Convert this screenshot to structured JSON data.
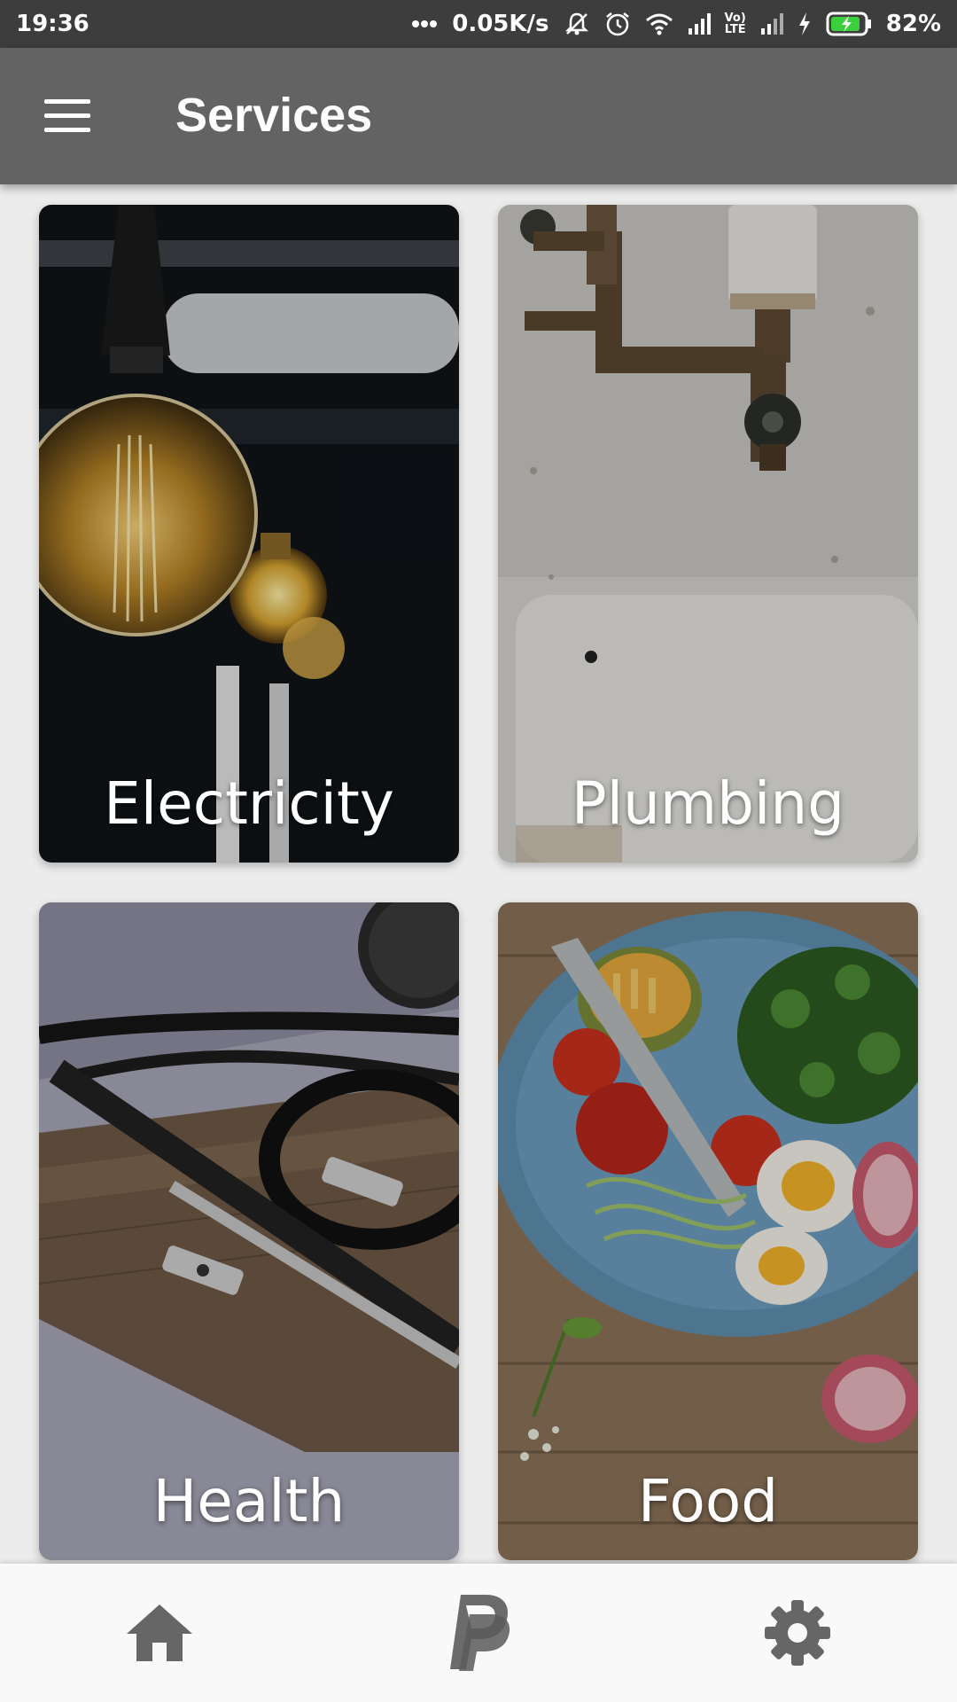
{
  "status_bar": {
    "time": "19:36",
    "network_speed": "0.05K/s",
    "volte_top": "Vo)",
    "volte_bottom": "LTE",
    "battery_percent": "82%",
    "icons": [
      "more-dots-icon",
      "mute-bell-icon",
      "alarm-icon",
      "wifi-icon",
      "signal-icon",
      "volte-icon",
      "signal-icon",
      "charging-icon",
      "battery-icon"
    ]
  },
  "app_bar": {
    "title": "Services",
    "menu_icon": "hamburger-menu-icon"
  },
  "services": [
    {
      "label": "Electricity",
      "image": "light-bulb-photo"
    },
    {
      "label": "Plumbing",
      "image": "pipes-and-sink-photo"
    },
    {
      "label": "Health",
      "image": "stethoscope-photo"
    },
    {
      "label": "Food",
      "image": "salad-plate-photo"
    }
  ],
  "bottom_nav": {
    "items": [
      {
        "icon": "home-icon"
      },
      {
        "icon": "paypal-icon"
      },
      {
        "icon": "settings-gear-icon"
      }
    ]
  },
  "colors": {
    "status_bar": "#3d3d3d",
    "app_bar": "#636363",
    "background": "#ececec",
    "bottom_nav": "#f9f9f9",
    "nav_icon": "#666666"
  }
}
